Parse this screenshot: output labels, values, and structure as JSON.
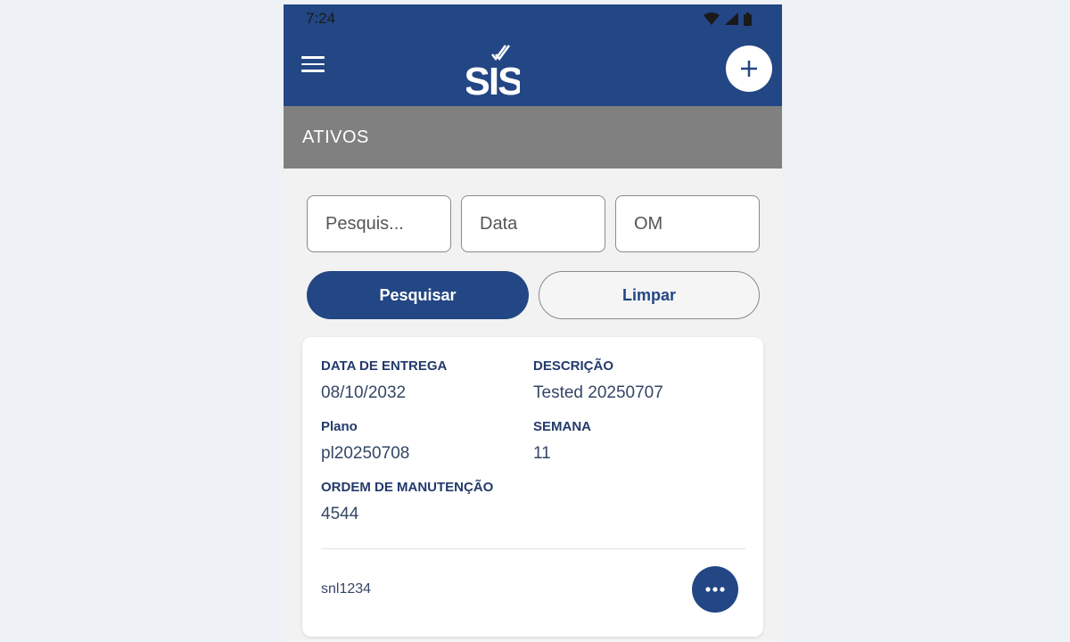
{
  "status_bar": {
    "time": "7:24",
    "icons": [
      "wifi-icon",
      "signal-icon",
      "battery-icon"
    ]
  },
  "app_bar": {
    "logo_text": "SIS",
    "menu_icon": "hamburger-icon",
    "add_icon": "plus-icon"
  },
  "section": {
    "title": "ATIVOS"
  },
  "filters": {
    "search_placeholder": "Pesquis...",
    "date_placeholder": "Data",
    "om_placeholder": "OM"
  },
  "actions": {
    "search_label": "Pesquisar",
    "clear_label": "Limpar"
  },
  "card": {
    "fields": [
      {
        "label": "DATA DE ENTREGA",
        "value": "08/10/2032"
      },
      {
        "label": "DESCRIÇÃO",
        "value": "Tested 20250707"
      },
      {
        "label": "Plano",
        "value": "pl20250708"
      },
      {
        "label": "SEMANA",
        "value": "11"
      },
      {
        "label": "ORDEM DE MANUTENÇÃO",
        "value": "4544"
      }
    ],
    "user": "snl1234",
    "more_icon": "more-horizontal-icon"
  },
  "colors": {
    "primary": "#234684",
    "section_bg": "#808080",
    "background": "#f2f2f2"
  }
}
